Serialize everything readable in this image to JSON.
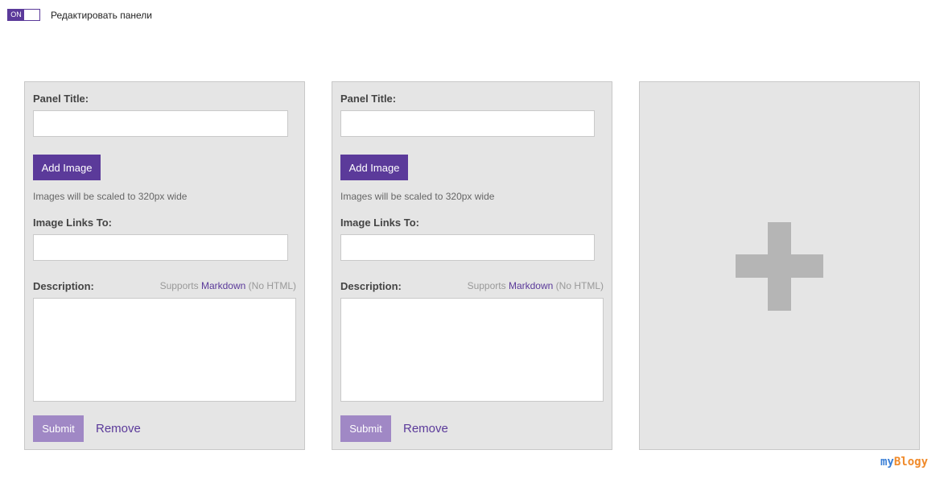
{
  "toggle": {
    "state": "ON",
    "label": "Редактировать панели"
  },
  "panels": [
    {
      "title_label": "Panel Title:",
      "title_value": "",
      "add_image_label": "Add Image",
      "image_hint": "Images will be scaled to 320px wide",
      "links_label": "Image Links To:",
      "links_value": "",
      "description_label": "Description:",
      "supports_prefix": "Supports",
      "supports_link": "Markdown",
      "supports_suffix": "(No HTML)",
      "description_value": "",
      "submit_label": "Submit",
      "remove_label": "Remove"
    },
    {
      "title_label": "Panel Title:",
      "title_value": "",
      "add_image_label": "Add Image",
      "image_hint": "Images will be scaled to 320px wide",
      "links_label": "Image Links To:",
      "links_value": "",
      "description_label": "Description:",
      "supports_prefix": "Supports",
      "supports_link": "Markdown",
      "supports_suffix": "(No HTML)",
      "description_value": "",
      "submit_label": "Submit",
      "remove_label": "Remove"
    }
  ],
  "add_panel": {
    "icon": "plus-icon"
  },
  "watermark": {
    "part1": "my",
    "part2": "Blogy"
  },
  "colors": {
    "accent": "#5b3a9a",
    "submit": "#a088c5",
    "panel_bg": "#e5e5e5",
    "plus": "#b5b5b5"
  }
}
